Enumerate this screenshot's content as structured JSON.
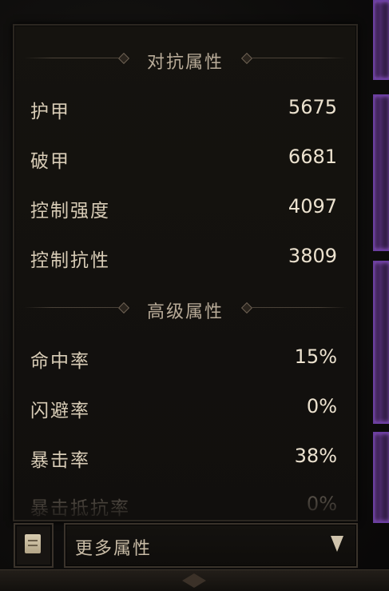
{
  "sections": [
    {
      "title": "对抗属性",
      "rows": [
        {
          "label": "护甲",
          "value": "5675"
        },
        {
          "label": "破甲",
          "value": "6681"
        },
        {
          "label": "控制强度",
          "value": "4097"
        },
        {
          "label": "控制抗性",
          "value": "3809"
        }
      ]
    },
    {
      "title": "高级属性",
      "rows": [
        {
          "label": "命中率",
          "value": "15%"
        },
        {
          "label": "闪避率",
          "value": "0%"
        },
        {
          "label": "暴击率",
          "value": "38%"
        },
        {
          "label": "暴击抵抗率",
          "value": "0%"
        }
      ]
    }
  ],
  "footer": {
    "icon": "scroll-icon",
    "dropdown_label": "更多属性",
    "dropdown_icon": "chevron-down-icon"
  },
  "colors": {
    "accent_purple": "#6b3fa0",
    "text_primary": "#d8ccb6",
    "panel_bg": "#110f0d"
  }
}
